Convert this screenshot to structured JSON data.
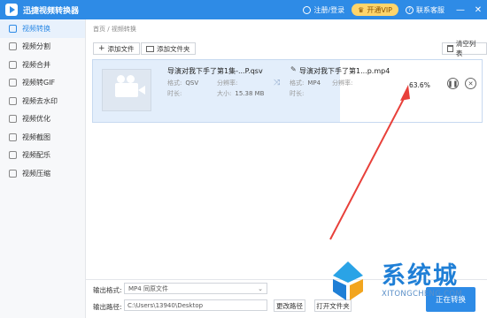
{
  "window": {
    "title": "迅捷视频转换器",
    "login": "注册/登录",
    "vip": "开通VIP",
    "contact": "联系客服",
    "minimize": "—",
    "close": "✕"
  },
  "sidebar": {
    "items": [
      {
        "label": "视频转换",
        "active": true
      },
      {
        "label": "视频分割"
      },
      {
        "label": "视频合并"
      },
      {
        "label": "视频转GIF"
      },
      {
        "label": "视频去水印"
      },
      {
        "label": "视频优化"
      },
      {
        "label": "视频截图"
      },
      {
        "label": "视频配乐"
      },
      {
        "label": "视频压缩"
      }
    ]
  },
  "breadcrumb": {
    "home": "首页",
    "sep": "/",
    "current": "视频转换"
  },
  "toolbar": {
    "add_file": "添加文件",
    "add_folder": "添加文件夹",
    "clear_list": "清空列表"
  },
  "file": {
    "source_name": "导演对我下手了第1集-...P.qsv",
    "source_format_label": "格式:",
    "source_format": "QSV",
    "source_resolution_label": "分辨率:",
    "source_resolution": "",
    "source_duration_label": "时长:",
    "source_duration": "",
    "source_size_label": "大小:",
    "source_size": "15.38 MB",
    "target_name": "导演对我下手了第1...p.mp4",
    "target_format_label": "格式:",
    "target_format": "MP4",
    "target_resolution_label": "分辨率:",
    "target_resolution": "",
    "target_duration_label": "时长:",
    "target_duration": "",
    "progress": "63.6%",
    "progress_value": 0.636
  },
  "bottom": {
    "format_label": "输出格式:",
    "format_value": "MP4  同原文件",
    "path_label": "输出路径:",
    "path_value": "C:\\Users\\13940\\Desktop",
    "change_path": "更改路径",
    "open_folder": "打开文件夹",
    "start": "正在转换"
  },
  "watermark": {
    "main": "系统城",
    "sub": "XITONGCHENG.COM"
  },
  "colors": {
    "brand": "#2e8be6",
    "annotation": "#e8403a",
    "vip": "#ffd56b"
  }
}
